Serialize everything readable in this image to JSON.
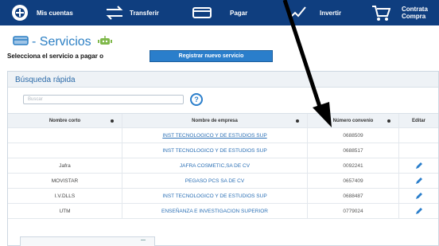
{
  "nav": {
    "items": [
      {
        "label": "Mis cuentas",
        "icon": "accounts-icon"
      },
      {
        "label": "Transferir",
        "icon": "transfer-icon"
      },
      {
        "label": "Pagar",
        "icon": "pay-card-icon"
      },
      {
        "label": "Invertir",
        "icon": "invest-icon"
      },
      {
        "label": "Contrata Compra",
        "icon": "cart-icon"
      }
    ]
  },
  "page": {
    "title": "- Servicios",
    "subtitle": "Selecciona el servicio a pagar o",
    "register_button": "Registrar nuevo servicio"
  },
  "quick_search": {
    "title": "Búsqueda rápida",
    "placeholder": "Buscar",
    "help": "?"
  },
  "table": {
    "headers": [
      "Nombre corto",
      "Nombre de empresa",
      "Número convenio",
      "Editar"
    ],
    "rows": [
      {
        "short": "",
        "company": "INST TECNOLOGICO Y DE ESTUDIOS SUP",
        "agreement": "0688509",
        "editable": false,
        "link": true
      },
      {
        "short": "",
        "company": "INST TECNOLOGICO Y DE ESTUDIOS SUP",
        "agreement": "0688517",
        "editable": false,
        "link": false
      },
      {
        "short": "Jafra",
        "company": "JAFRA COSMETIC,SA DE CV",
        "agreement": "0092241",
        "editable": true,
        "link": false
      },
      {
        "short": "MOVISTAR",
        "company": "PEGASO PCS SA DE CV",
        "agreement": "0657409",
        "editable": true,
        "link": false
      },
      {
        "short": "I.V.DLLS",
        "company": "INST TECNOLOGICO Y DE ESTUDIOS SUP",
        "agreement": "0688487",
        "editable": true,
        "link": false
      },
      {
        "short": "UTM",
        "company": "ENSEÑANZA E INVESTIGACION SUPERIOR",
        "agreement": "0779024",
        "editable": true,
        "link": false
      }
    ]
  },
  "colors": {
    "nav_bg": "#0f3e7f",
    "accent": "#2a7ecb",
    "link": "#2a6fb5"
  }
}
